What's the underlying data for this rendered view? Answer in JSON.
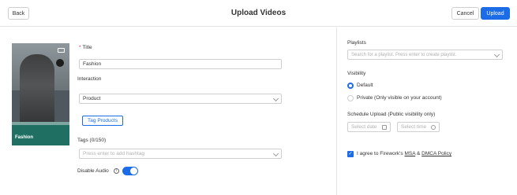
{
  "header": {
    "back_label": "Back",
    "title": "Upload Videos",
    "cancel_label": "Cancel",
    "upload_label": "Upload"
  },
  "thumbnail": {
    "caption": "Fashion",
    "camera_icon": "camera-icon"
  },
  "form": {
    "title_label": "Title",
    "title_value": "Fashion",
    "interaction_label": "Interaction",
    "interaction_value": "Product",
    "tag_products_label": "Tag Products",
    "tags_label": "Tags (0/150)",
    "tags_placeholder": "Press enter to add hashtag",
    "disable_audio_label": "Disable Audio",
    "info_icon": "i",
    "disable_audio_on": true
  },
  "sidebar": {
    "playlists_label": "Playlists",
    "playlists_placeholder": "Search for a playlist. Press enter to create playlist.",
    "visibility_label": "Visibility",
    "visibility_options": [
      {
        "label": "Default",
        "selected": true
      },
      {
        "label": "Private (Only visible on your account)",
        "selected": false
      }
    ],
    "schedule_label": "Schedule Upload (Public visibility only)",
    "date_placeholder": "Select date",
    "time_placeholder": "Select time",
    "agree_prefix": "I agree to Firework's ",
    "msa_link": "MSA",
    "agree_and": " & ",
    "dmca_link": "DMCA Policy",
    "agree_checked": true,
    "checkmark": "✓"
  },
  "colors": {
    "accent": "#1b6ce6",
    "required": "#d9362b"
  }
}
